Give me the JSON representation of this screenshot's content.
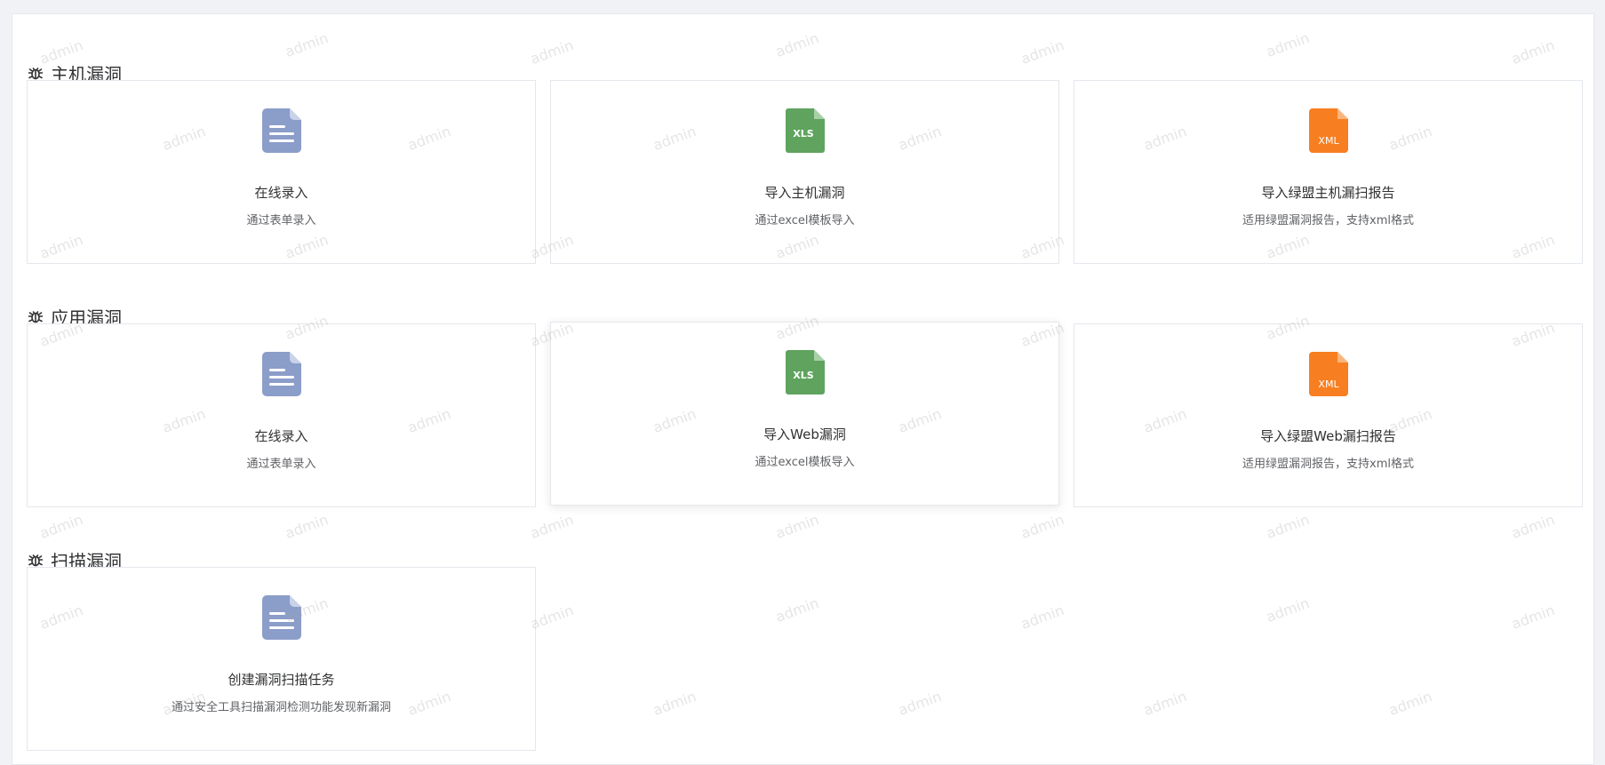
{
  "watermark_text": "admin",
  "sections": [
    {
      "title": "主机漏洞",
      "cards": [
        {
          "icon": "document-icon",
          "title": "在线录入",
          "desc": "通过表单录入"
        },
        {
          "icon": "xls-file-icon",
          "title": "导入主机漏洞",
          "desc": "通过excel模板导入",
          "icon_label": "XLS"
        },
        {
          "icon": "xml-file-icon",
          "title": "导入绿盟主机漏扫报告",
          "desc": "适用绿盟漏洞报告，支持xml格式",
          "icon_label": "XML"
        }
      ]
    },
    {
      "title": "应用漏洞",
      "cards": [
        {
          "icon": "document-icon",
          "title": "在线录入",
          "desc": "通过表单录入"
        },
        {
          "icon": "xls-file-icon",
          "title": "导入Web漏洞",
          "desc": "通过excel模板导入",
          "icon_label": "XLS"
        },
        {
          "icon": "xml-file-icon",
          "title": "导入绿盟Web漏扫报告",
          "desc": "适用绿盟漏洞报告，支持xml格式",
          "icon_label": "XML"
        }
      ]
    },
    {
      "title": "扫描漏洞",
      "cards": [
        {
          "icon": "document-icon",
          "title": "创建漏洞扫描任务",
          "desc": "通过安全工具扫描漏洞检测功能发现新漏洞"
        }
      ]
    }
  ],
  "colors": {
    "doc_icon": "#8b9dc9",
    "xls_icon": "#5fa35e",
    "xml_icon": "#f77f21"
  }
}
